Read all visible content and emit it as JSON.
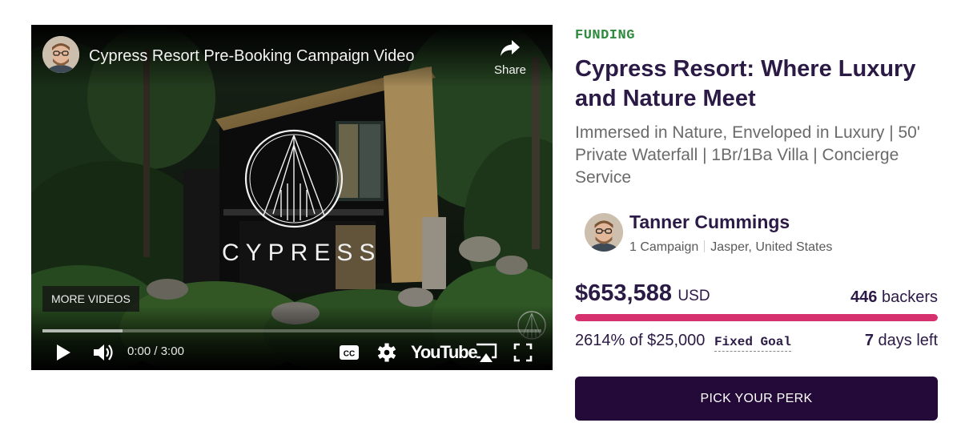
{
  "video": {
    "title": "Cypress Resort Pre-Booking Campaign Video",
    "share_label": "Share",
    "brand_word": "CYPRESS",
    "more_videos_label": "MORE VIDEOS",
    "current_time": "0:00",
    "duration": "3:00",
    "buffered_fraction": 0.16,
    "youtube_label": "YouTube"
  },
  "campaign": {
    "category": "FUNDING",
    "title": "Cypress Resort: Where Luxury and Nature Meet",
    "tagline": "Immersed in Nature, Enveloped in Luxury | 50' Private Waterfall | 1Br/1Ba Villa | Concierge Service",
    "creator": {
      "name": "Tanner Cummings",
      "campaign_count": "1 Campaign",
      "location": "Jasper, United States"
    },
    "amount_raised": "$653,588",
    "currency": "USD",
    "backers_count": "446",
    "backers_label": "backers",
    "percent_funded": "2614%",
    "goal_text": "of $25,000",
    "goal_type": "Fixed Goal",
    "days_left_count": "7",
    "days_left_label": "days left",
    "progress_fraction": 1.0,
    "perk_button_label": "PICK YOUR PERK"
  },
  "colors": {
    "category": "#2e8b3d",
    "title": "#2a1a45",
    "progress": "#d7306e",
    "button": "#230a39"
  },
  "icons": [
    "play-icon",
    "volume-icon",
    "closed-captions-icon",
    "settings-gear-icon",
    "airplay-icon",
    "fullscreen-icon",
    "share-arrow-icon"
  ]
}
